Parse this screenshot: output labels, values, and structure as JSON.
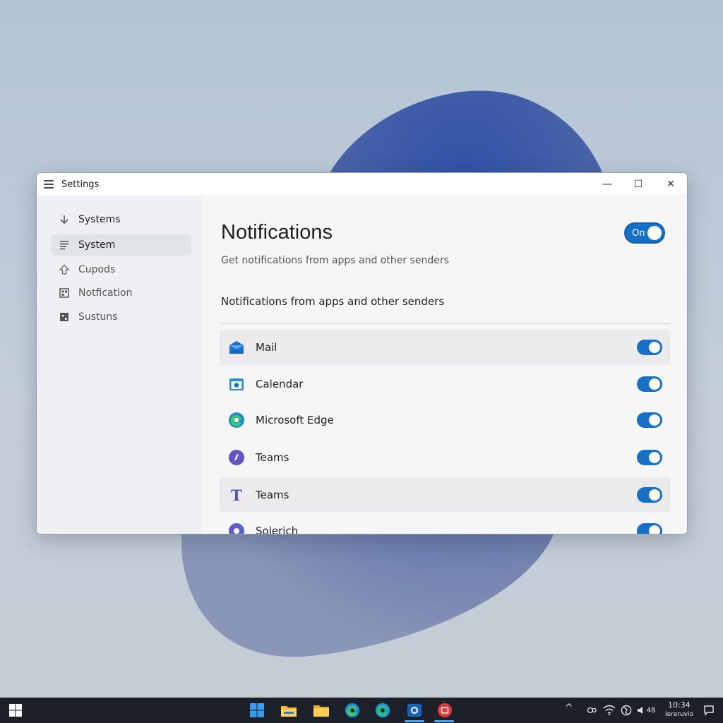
{
  "window": {
    "title": "Settings",
    "controls": {
      "minimize": "—",
      "maximize": "☐",
      "close": "✕"
    }
  },
  "sidebar": {
    "items": [
      {
        "label": "Systems",
        "icon": "download-arrow-icon",
        "selected": false
      },
      {
        "label": "System",
        "icon": "list-lines-icon",
        "selected": true
      },
      {
        "label": "Cupods",
        "icon": "up-arrow-outline-icon",
        "selected": false
      },
      {
        "label": "Notfication",
        "icon": "grid-square-icon",
        "selected": false
      },
      {
        "label": "Sustuns",
        "icon": "grid-square-filled-icon",
        "selected": false
      }
    ]
  },
  "main": {
    "title": "Notifications",
    "subtitle": "Get notifications from apps and other senders",
    "master_toggle": {
      "label": "On",
      "state": true
    },
    "section_title": "Notifications from apps and other senders",
    "apps": [
      {
        "name": "Mail",
        "icon": "mail-icon",
        "enabled": true
      },
      {
        "name": "Calendar",
        "icon": "calendar-icon",
        "enabled": true
      },
      {
        "name": "Microsoft Edge",
        "icon": "edge-icon",
        "enabled": true
      },
      {
        "name": "Teams",
        "icon": "teams-circle-icon",
        "enabled": true
      },
      {
        "name": "Teams",
        "icon": "teams-t-icon",
        "enabled": true
      },
      {
        "name": "Solerich",
        "icon": "app-circle-icon",
        "enabled": true
      }
    ]
  },
  "taskbar": {
    "start_icon": "windows-start-icon",
    "pinned": [
      "windows-logo-icon",
      "file-explorer-icon",
      "folder-icon",
      "edge-icon",
      "edge-icon",
      "store-app-icon",
      "red-app-icon"
    ],
    "tray": {
      "chevron": "^",
      "clock_time": "10:34",
      "clock_date": "Iereruvio",
      "volume_label": "4ß"
    }
  },
  "colors": {
    "accent": "#1670c8",
    "taskbar": "#1c2029",
    "blob": "#3e5aa8"
  }
}
